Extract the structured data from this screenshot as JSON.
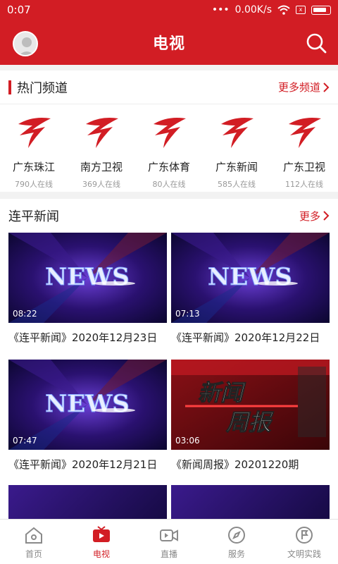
{
  "status_bar": {
    "time": "0:07",
    "network_speed": "0.00K/s",
    "sim_label": "x"
  },
  "header": {
    "title": "电视"
  },
  "hot_channels": {
    "title": "热门频道",
    "more_label": "更多频道",
    "items": [
      {
        "name": "广东珠江",
        "online": "790人在线"
      },
      {
        "name": "南方卫视",
        "online": "369人在线"
      },
      {
        "name": "广东体育",
        "online": "80人在线"
      },
      {
        "name": "广东新闻",
        "online": "585人在线"
      },
      {
        "name": "广东卫视",
        "online": "112人在线"
      }
    ]
  },
  "news": {
    "title": "连平新闻",
    "more_label": "更多",
    "videos": [
      {
        "duration": "08:22",
        "caption": "《连平新闻》2020年12月23日",
        "thumb_text": "NEWS"
      },
      {
        "duration": "07:13",
        "caption": "《连平新闻》2020年12月22日",
        "thumb_text": "NEWS"
      },
      {
        "duration": "07:47",
        "caption": "《连平新闻》2020年12月21日",
        "thumb_text": "NEWS"
      },
      {
        "duration": "03:06",
        "caption": "《新闻周报》20201220期",
        "thumb_text_1": "新闻",
        "thumb_text_2": "周报"
      }
    ]
  },
  "bottom_nav": [
    {
      "label": "首页",
      "icon": "home-icon",
      "active": false
    },
    {
      "label": "电视",
      "icon": "tv-icon",
      "active": true
    },
    {
      "label": "直播",
      "icon": "video-camera-icon",
      "active": false
    },
    {
      "label": "服务",
      "icon": "compass-icon",
      "active": false
    },
    {
      "label": "文明实践",
      "icon": "flag-icon",
      "active": false
    }
  ],
  "colors": {
    "brand_red": "#d21d24",
    "text": "#222222",
    "muted": "#999999"
  }
}
